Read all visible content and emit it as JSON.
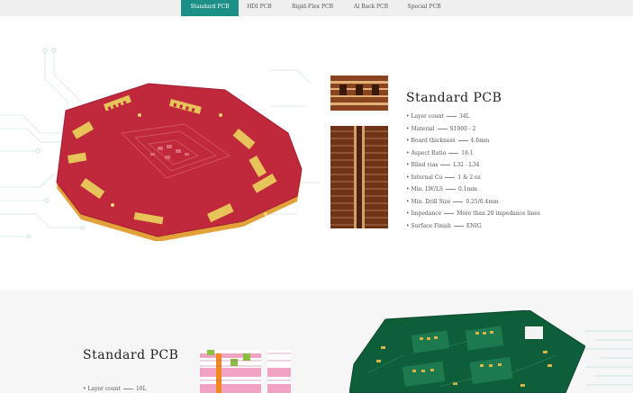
{
  "tabs": [
    {
      "label": "Standard PCB",
      "active": true
    },
    {
      "label": "HDI PCB",
      "active": false
    },
    {
      "label": "Rigid-Flex PCB",
      "active": false
    },
    {
      "label": "Al Back PCB",
      "active": false
    },
    {
      "label": "Special PCB",
      "active": false
    }
  ],
  "section1": {
    "title": "Standard PCB",
    "specs": [
      {
        "label": "Layer count",
        "value": "34L"
      },
      {
        "label": "Material",
        "value": "S1000 - 2"
      },
      {
        "label": "Board thickness",
        "value": "4.6mm"
      },
      {
        "label": "Aspect Ratio",
        "value": "18:1"
      },
      {
        "label": "Blind vias",
        "value": "L32 - L34"
      },
      {
        "label": "Internal Cu",
        "value": "1 & 2 oz"
      },
      {
        "label": "Min. LW/LS",
        "value": "0.1mm"
      },
      {
        "label": "Min. Drill Size",
        "value": "0.25/0.4mm"
      },
      {
        "label": "Impedance",
        "value": "More than 20 impedance lines"
      },
      {
        "label": "Surface Finish",
        "value": "ENIG"
      }
    ]
  },
  "section2": {
    "title": "Standard PCB",
    "specs": [
      {
        "label": "Layer count",
        "value": "16L"
      }
    ]
  },
  "colors": {
    "accent": "#1c8f87",
    "board_red": "#c0283c",
    "board_green": "#0f5e3a",
    "gold": "#e0b840"
  }
}
